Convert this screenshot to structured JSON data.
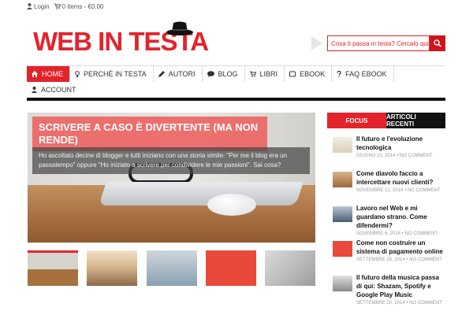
{
  "topbar": {
    "login_label": "Login",
    "cart_label": "0 items - €0.00"
  },
  "logo": {
    "text": "WEB IN TESTA"
  },
  "search": {
    "placeholder": "Cosa ti passa in testa? Cercalo qui"
  },
  "nav": {
    "items": [
      {
        "label": "HOME",
        "icon": "home-icon"
      },
      {
        "label": "PERCHÈ IN TESTA",
        "icon": "bulb-icon"
      },
      {
        "label": "AUTORI",
        "icon": "pencil-icon"
      },
      {
        "label": "BLOG",
        "icon": "chat-icon"
      },
      {
        "label": "LIBRI",
        "icon": "cart-icon"
      },
      {
        "label": "EBOOK",
        "icon": "tablet-icon"
      },
      {
        "label": "FAQ EBOOK",
        "icon": "question-icon"
      },
      {
        "label": "ACCOUNT",
        "icon": "user-icon"
      }
    ]
  },
  "hero": {
    "title": "SCRIVERE A CASO È DIVERTENTE (MA NON RENDE)",
    "excerpt": "Ho ascoltato decine di blogger e tutti iniziano con una storia simile: \"Per me il blog era un passatempo\" oppure \"Ho iniziato a scrivere per condividere le mie passioni\". Sai cosa?"
  },
  "sidebar": {
    "tabs": [
      "FOCUS",
      "ARTICOLI RECENTI"
    ],
    "items": [
      {
        "title": "Il futuro e l'evoluzione tecnologica",
        "meta": "GIUGNO 10, 2014 • NO COMMENT"
      },
      {
        "title": "Come diavolo faccio a intercettare nuovi clienti?",
        "meta": "NOVEMBRE 12, 2014 • NO COMMENT"
      },
      {
        "title": "Lavoro nel Web e mi guardano strano. Come difendermi?",
        "meta": "NOVEMBRE 6, 2014 • NO COMMENT"
      },
      {
        "title": "Come non costruire un sistema di pagamento online",
        "meta": "SETTEMBRE 28, 2014 • NO COMMENT"
      },
      {
        "title": "Il futuro della musica passa di qui: Shazam, Spotify e Google Play Music",
        "meta": "SETTEMBRE 20, 2014 • NO COMMENT"
      }
    ]
  },
  "colors": {
    "accent": "#e3232c",
    "dark": "#111111"
  }
}
